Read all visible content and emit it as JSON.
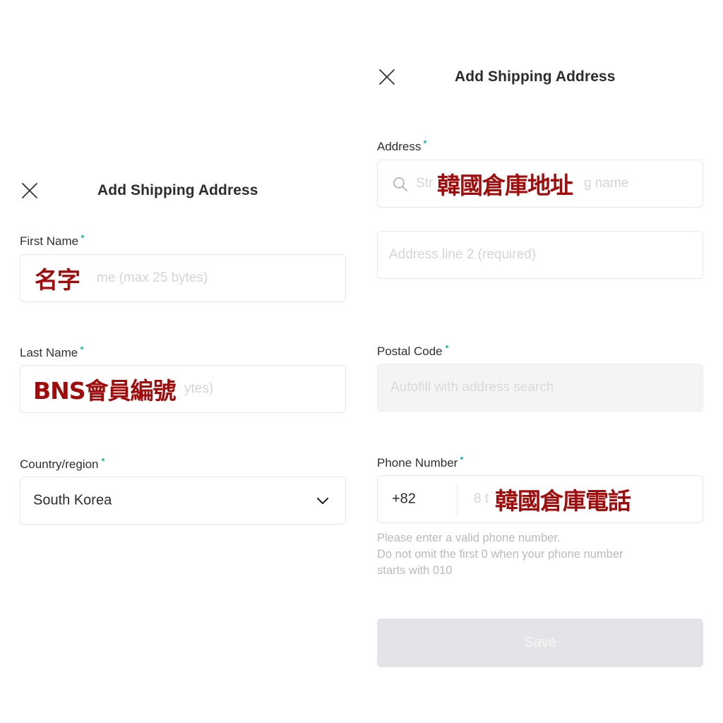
{
  "left_panel": {
    "header": {
      "title": "Add Shipping Address",
      "close_icon": "close-icon"
    },
    "fields": {
      "first_name": {
        "label": "First Name",
        "required": true,
        "placeholder_visible": "me (max 25 bytes)",
        "overlay_text": "名字"
      },
      "last_name": {
        "label": "Last Name",
        "required": true,
        "placeholder_visible": "ytes)",
        "overlay_text": "BNS會員編號"
      },
      "country": {
        "label": "Country/region",
        "required": true,
        "value": "South Korea",
        "icon": "chevron-down-icon"
      }
    }
  },
  "right_panel": {
    "header": {
      "title": "Add Shipping Address",
      "close_icon": "close-icon"
    },
    "fields": {
      "address": {
        "label": "Address",
        "required": true,
        "icon": "search-icon",
        "placeholder_left": "Str",
        "placeholder_right": "g name",
        "overlay_text": "韓國倉庫地址"
      },
      "address_line2": {
        "placeholder": "Address line 2 (required)"
      },
      "postal_code": {
        "label": "Postal Code",
        "required": true,
        "placeholder": "Autofill with address search",
        "disabled": true
      },
      "phone": {
        "label": "Phone Number",
        "required": true,
        "country_code": "+82",
        "placeholder_visible": "8 t",
        "overlay_text": "韓國倉庫電話",
        "help_lines": [
          "Please enter a valid phone number.",
          "Do not omit the first 0 when your phone number",
          "starts with 010"
        ]
      }
    },
    "save_button": {
      "label": "Save",
      "disabled": true
    }
  },
  "colors": {
    "required_dot": "#2cc8b4",
    "overlay_text": "#a30b0b",
    "save_disabled_bg": "#e3e4e7"
  }
}
